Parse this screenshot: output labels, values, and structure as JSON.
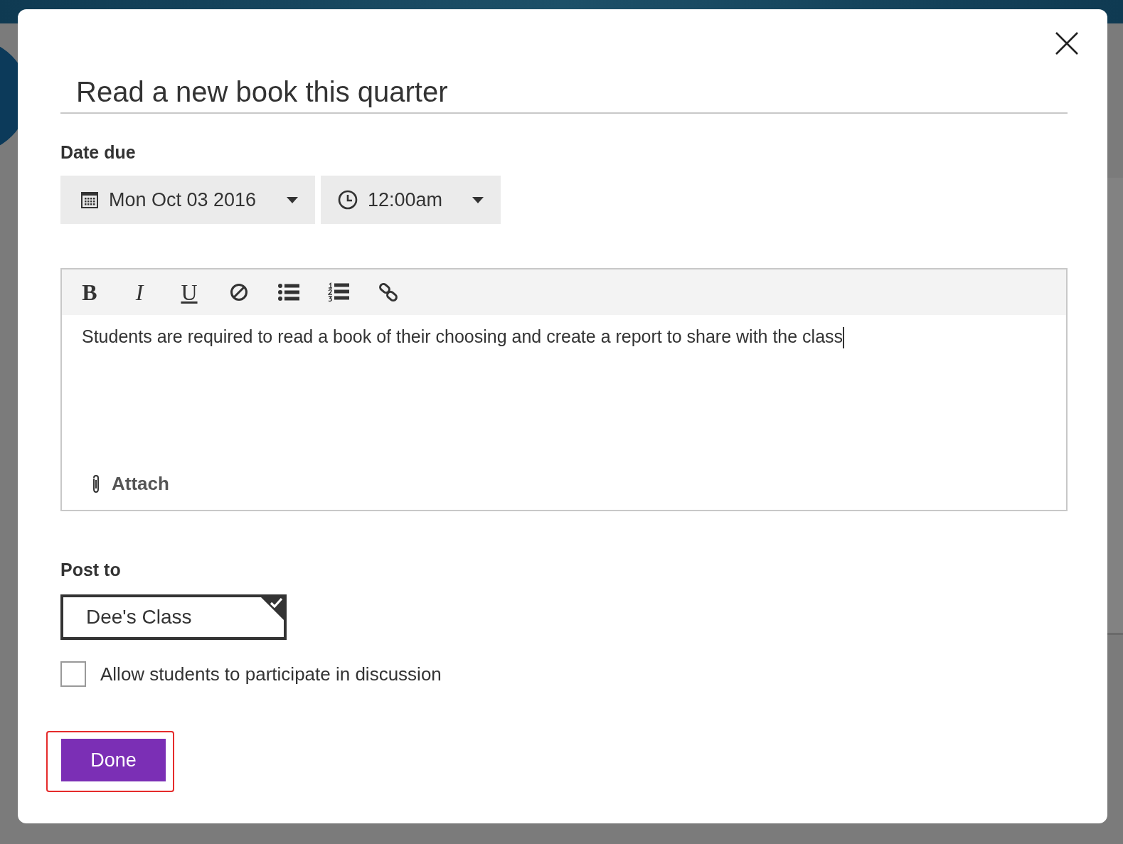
{
  "dialog": {
    "title": "Read a new book this quarter",
    "date_due": {
      "label": "Date due",
      "date": "Mon Oct 03 2016",
      "time": "12:00am"
    },
    "editor": {
      "toolbar": [
        {
          "kind": "bold",
          "label": "B"
        },
        {
          "kind": "italic",
          "label": "I"
        },
        {
          "kind": "underline",
          "label": "U"
        },
        {
          "kind": "clear"
        },
        {
          "kind": "bullets"
        },
        {
          "kind": "numbers"
        },
        {
          "kind": "link"
        }
      ],
      "text": "Students are required to read a book of their choosing and create a report to share with the class",
      "attach": "Attach"
    },
    "post_to": {
      "label": "Post to",
      "classes": [
        {
          "name": "Dee's Class",
          "selected": true
        }
      ]
    },
    "discussion": {
      "label": "Allow students to participate in discussion",
      "checked": false
    },
    "done": {
      "label": "Done",
      "highlighted": true
    }
  }
}
